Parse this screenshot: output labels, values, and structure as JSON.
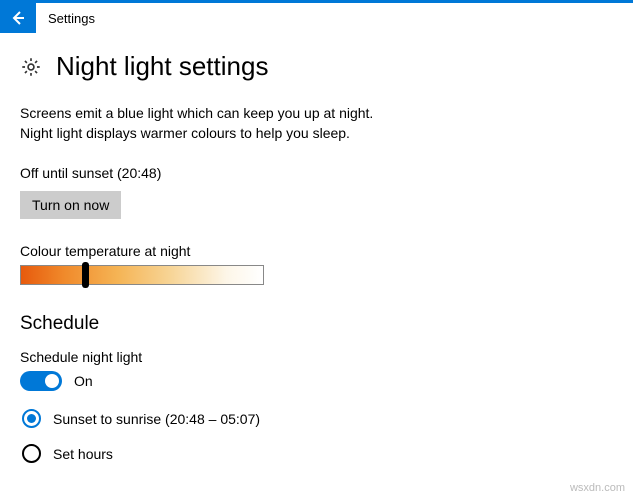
{
  "app_title": "Settings",
  "page": {
    "title": "Night light settings",
    "description": "Screens emit a blue light which can keep you up at night. Night light displays warmer colours to help you sleep.",
    "status": "Off until sunset (20:48)",
    "turn_on_label": "Turn on now",
    "color_temp_label": "Colour temperature at night"
  },
  "schedule": {
    "heading": "Schedule",
    "label": "Schedule night light",
    "toggle_state": "On",
    "options": {
      "sunset": "Sunset to sunrise (20:48 – 05:07)",
      "set_hours": "Set hours"
    }
  },
  "colors": {
    "accent": "#0078d7"
  },
  "watermark": "wsxdn.com"
}
